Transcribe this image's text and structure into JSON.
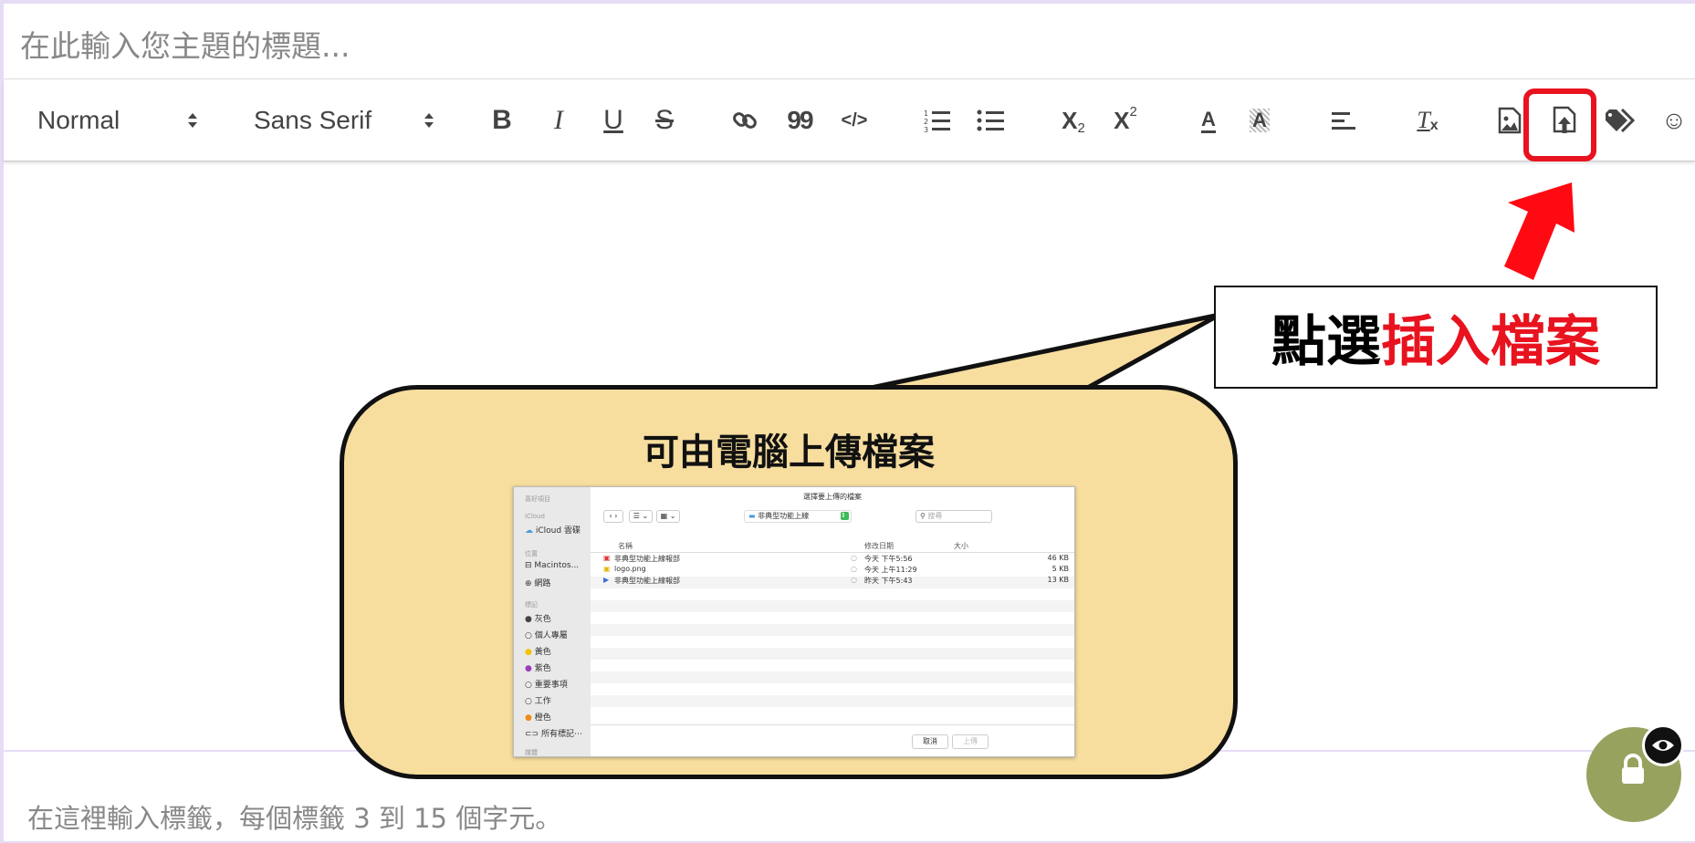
{
  "title_input": {
    "placeholder": "在此輸入您主題的標題..."
  },
  "toolbar": {
    "header_picker": "Normal",
    "font_picker": "Sans Serif",
    "buttons": [
      "bold-icon",
      "italic-icon",
      "underline-icon",
      "strikethrough-icon",
      "link-icon",
      "blockquote-icon",
      "code-icon",
      "ordered-list-icon",
      "bullet-list-icon",
      "subscript-icon",
      "superscript-icon",
      "text-color-icon",
      "background-color-icon",
      "align-icon",
      "clear-format-icon",
      "insert-image-icon",
      "insert-file-icon",
      "tag-icon",
      "emoji-icon"
    ],
    "bold_glyph": "B",
    "italic_glyph": "I",
    "underline_glyph": "U",
    "strike_glyph": "S",
    "quote_glyph": "99",
    "code_glyph": "</>",
    "sub_glyph": "X",
    "sub_small": "2",
    "sup_glyph": "X",
    "sup_small": "2",
    "color_glyph": "A",
    "bg_glyph": "A",
    "clear_glyph": "T",
    "clear_small": "x",
    "emoji_glyph": "☺"
  },
  "annotation": {
    "callout_prefix": "點選",
    "callout_highlight": "插入檔案",
    "highlight_color": "#e8131f",
    "bubble_title": "可由電腦上傳檔案",
    "bubble_color": "#f7de9f"
  },
  "file_dialog": {
    "title": "選擇要上傳的檔案",
    "folder": "非典型功能上線",
    "search_placeholder": "搜尋",
    "view_list": "☰ ⌄",
    "view_grid": "▦ ⌄",
    "sidebar": {
      "favorites_header": "喜好項目",
      "icloud_header": "iCloud",
      "icloud_drive": "iCloud 雲碟",
      "locations_header": "位置",
      "macintosh": "Macintos...",
      "network": "網路",
      "tags_header": "標記",
      "tags": [
        {
          "label": "灰色",
          "color": "#444444"
        },
        {
          "label": "個人專屬",
          "color": ""
        },
        {
          "label": "黃色",
          "color": "#f2c300"
        },
        {
          "label": "紫色",
          "color": "#9b3fbf"
        },
        {
          "label": "重要事項",
          "color": ""
        },
        {
          "label": "工作",
          "color": ""
        },
        {
          "label": "橙色",
          "color": "#f08a1c"
        }
      ],
      "all_tags": "所有標記⋯",
      "bottom_cut": "媒體"
    },
    "columns": {
      "name": "名稱",
      "date": "修改日期",
      "size": "大小"
    },
    "files": [
      {
        "name": "非典型功能上線報部",
        "date": "今天 下午5:56",
        "size": "46 KB"
      },
      {
        "name": "logo.png",
        "date": "今天 上午11:29",
        "size": "5 KB"
      },
      {
        "name": "非典型功能上線報部",
        "date": "昨天 下午5:43",
        "size": "13 KB"
      }
    ],
    "cancel_label": "取消",
    "upload_label": "上傳"
  },
  "tags_input": {
    "placeholder": "在這裡輸入標籤，每個標籤 3 到 15 個字元。"
  },
  "badges": {
    "lock_icon": "lock-icon",
    "eye_icon": "eye-icon",
    "lock_color": "#98a25f"
  }
}
